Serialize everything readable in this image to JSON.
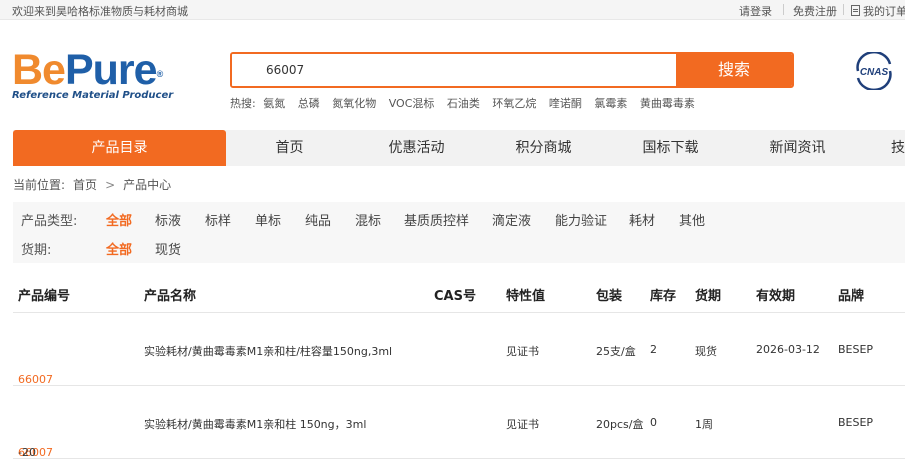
{
  "topbar": {
    "welcome": "欢迎来到昊哈格标准物质与耗材商城",
    "login": "请登录",
    "register": "免费注册",
    "orders": "我的订单"
  },
  "logo": {
    "be": "Be",
    "pure": "Pure",
    "reg": "®",
    "tagline": "Reference Material Producer"
  },
  "search": {
    "value": "66007",
    "button": "搜索",
    "hot_label": "热搜:",
    "hot_terms": [
      "氨氮",
      "总磷",
      "氮氧化物",
      "VOC混标",
      "石油类",
      "环氧乙烷",
      "喹诺酮",
      "氯霉素",
      "黄曲霉毒素"
    ]
  },
  "cnas": {
    "text": "CNAS"
  },
  "nav": {
    "items": [
      "产品目录",
      "首页",
      "优惠活动",
      "积分商城",
      "国标下载",
      "新闻资讯",
      "技"
    ]
  },
  "breadcrumb": {
    "label": "当前位置:",
    "home": "首页",
    "arrow": ">",
    "current": "产品中心"
  },
  "filters": {
    "type_label": "产品类型:",
    "types": [
      "全部",
      "标液",
      "标样",
      "单标",
      "纯品",
      "混标",
      "基质质控样",
      "滴定液",
      "能力验证",
      "耗材",
      "其他"
    ],
    "stock_label": "货期:",
    "stock_options": [
      "全部",
      "现货"
    ]
  },
  "table": {
    "headers": [
      "产品编号",
      "产品名称",
      "CAS号",
      "特性值",
      "包装",
      "库存",
      "货期",
      "有效期",
      "品牌"
    ],
    "rows": [
      {
        "code": "66007",
        "suffix": "",
        "name": "实验耗材/黄曲霉毒素M1亲和柱/柱容量150ng,3ml",
        "cas": "",
        "value": "见证书",
        "pack": "25支/盒",
        "stock": "2",
        "lead": "现货",
        "expiry": "2026-03-12",
        "brand": "BESEP"
      },
      {
        "code": "66007",
        "suffix": "-20",
        "name": "实验耗材/黄曲霉毒素M1亲和柱 150ng，3ml",
        "cas": "",
        "value": "见证书",
        "pack": "20pcs/盒",
        "stock": "0",
        "lead": "1周",
        "expiry": "",
        "brand": "BESEP"
      }
    ]
  },
  "colors": {
    "accent": "#f26a21",
    "logo_orange": "#f08a2e",
    "logo_blue": "#1f5fa8"
  }
}
